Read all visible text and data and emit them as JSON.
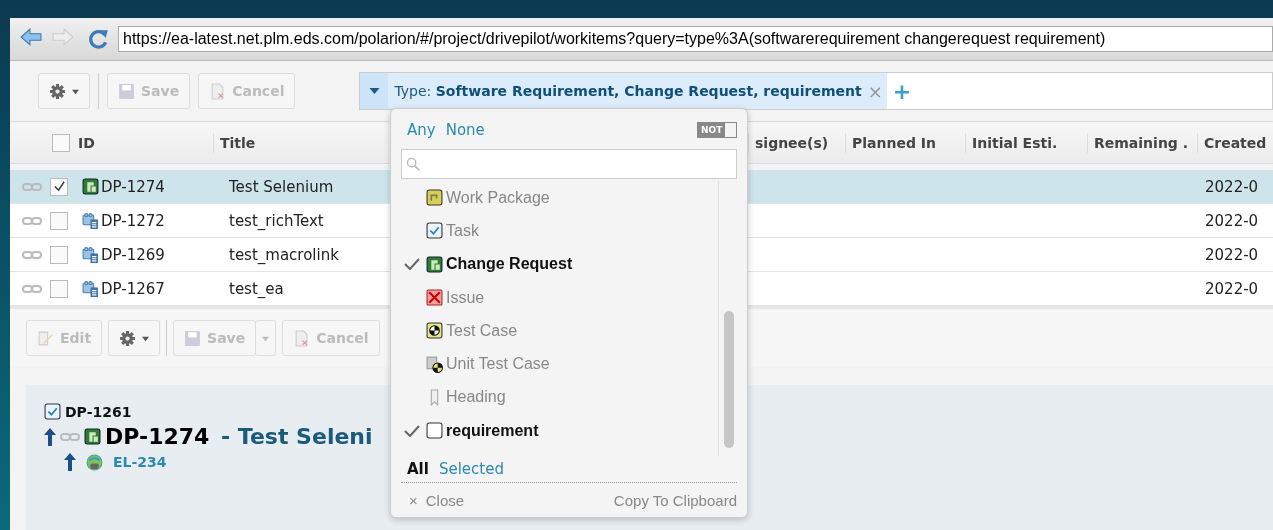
{
  "address_bar": {
    "url": "https://ea-latest.net.plm.eds.com/polarion/#/project/drivepilot/workitems?query=type%3A(softwarerequirement changerequest requirement)"
  },
  "toolbar": {
    "buttons": [
      {
        "kind": "gear",
        "disabled": false
      },
      {
        "kind": "save",
        "label": "Save",
        "disabled": true
      },
      {
        "kind": "cancel",
        "label": "Cancel",
        "disabled": true
      }
    ]
  },
  "filter": {
    "text": "Type: **Software Requirement, Change Request, requirement**",
    "remove": "×",
    "add": "+"
  },
  "table": {
    "select_all": {
      "checked": false
    },
    "columns": [
      {
        "label": "ID"
      },
      {
        "label": "Title"
      },
      {
        "label": "signee(s)"
      },
      {
        "label": "Planned In"
      },
      {
        "label": "Initial Esti."
      },
      {
        "label": "Remaining ."
      },
      {
        "label": "Created"
      }
    ],
    "rows": [
      {
        "id": "DP-1274",
        "title": "Test Selenium",
        "created": "2022-0",
        "kind": "change_request",
        "selected": true,
        "checked": true
      },
      {
        "id": "DP-1272",
        "title": "test_richText",
        "created": "2022-0",
        "kind": "software_requirement",
        "selected": false,
        "checked": false
      },
      {
        "id": "DP-1269",
        "title": "test_macrolink",
        "created": "2022-0",
        "kind": "software_requirement",
        "selected": false,
        "checked": false
      },
      {
        "id": "DP-1267",
        "title": "test_ea",
        "created": "2022-0",
        "kind": "software_requirement",
        "selected": false,
        "checked": false
      }
    ]
  },
  "detail_toolbar": {
    "buttons": [
      {
        "kind": "edit",
        "label": "Edit",
        "disabled": true
      },
      {
        "kind": "gear",
        "disabled": false
      },
      {
        "kind": "save",
        "label": "Save",
        "disabled": true
      },
      {
        "kind": "dropdown",
        "disabled": true
      },
      {
        "kind": "cancel",
        "label": "Cancel",
        "disabled": true
      }
    ]
  },
  "detail": {
    "parent": {
      "id": "DP-1261",
      "kind": "task"
    },
    "id": "DP-1274",
    "title": "- Test Seleni",
    "kind": "change_request",
    "child": {
      "id": "EL-234",
      "kind": "external"
    }
  },
  "type_popup": {
    "links": [
      "Any",
      "None"
    ],
    "not_toggle": {
      "label": "NOT",
      "on": false
    },
    "items": [
      {
        "label": "Work Package",
        "kind": "work_package",
        "checked": false
      },
      {
        "label": "Task",
        "kind": "task",
        "checked": false
      },
      {
        "label": "Change Request",
        "kind": "change_request",
        "checked": true
      },
      {
        "label": "Issue",
        "kind": "issue",
        "checked": false
      },
      {
        "label": "Test Case",
        "kind": "test_case",
        "checked": false
      },
      {
        "label": "Unit Test Case",
        "kind": "unit_test_case",
        "checked": false
      },
      {
        "label": "Heading",
        "kind": "heading",
        "checked": false
      },
      {
        "label": "requirement",
        "kind": "requirement",
        "checked": true
      }
    ],
    "tabs": [
      {
        "label": "All",
        "selected": true
      },
      {
        "label": "Selected",
        "selected": false
      }
    ],
    "close": {
      "icon": "×",
      "label": "Close"
    },
    "copy": "Copy To Clipboard"
  }
}
